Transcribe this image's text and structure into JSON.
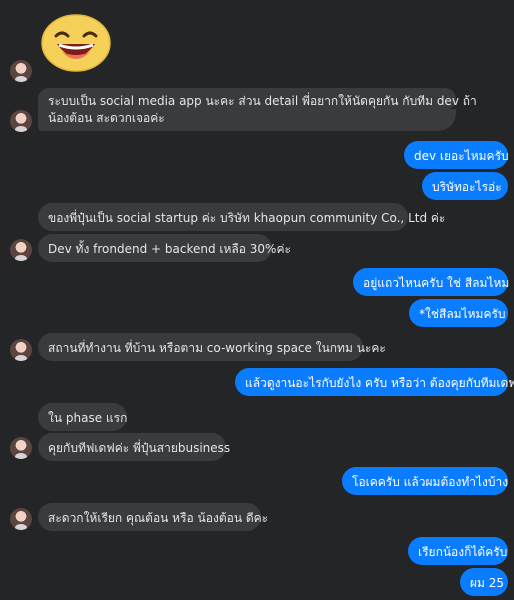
{
  "messages": [
    {
      "side": "in",
      "text": "ระบบเป็น social media app นะคะ ส่วน detail พี่อยากให้นัดคุยกัน กับทีม dev ถ้า"
    },
    {
      "side": "in",
      "text": "น้องต้อน สะดวกเจอค่ะ"
    },
    {
      "side": "out",
      "text": "dev เยอะไหมครับ"
    },
    {
      "side": "out",
      "text": "บริษัทอะไรอ่ะ"
    },
    {
      "side": "in",
      "text": "ของพี่ปุ๋นเป็น social startup ค่ะ บริษัท khaopun community Co., Ltd ค่ะ"
    },
    {
      "side": "in",
      "text": "Dev ทั้ง frondend + backend เหลือ 30%ค่ะ"
    },
    {
      "side": "out",
      "text": "อยู่แถวไหนครับ ใช่ สีลมไหม"
    },
    {
      "side": "out",
      "text": "*ใช่สีลมไหมครับ"
    },
    {
      "side": "in",
      "text": "สถานที่ทำงาน ที่บ้าน หรือตาม co-working space ในกทม นะคะ"
    },
    {
      "side": "out",
      "text": "แล้วดูงานอะไรกับยังไง ครับ หรือว่า ต้องคุยกับทีมเดฟ"
    },
    {
      "side": "in",
      "text": "ใน phase แรก"
    },
    {
      "side": "in",
      "text": "คุยกับทีฟเดฟค่ะ พี่ปุ๋นสายbusiness"
    },
    {
      "side": "out",
      "text": "โอเคครับ แล้วผมต้องทำไงบ้าง"
    },
    {
      "side": "in",
      "text": "สะดวกให้เรียก คุณต้อน หรือ น้องต้อน ดีคะ"
    },
    {
      "side": "out",
      "text": "เรียกน้องก็ได้ครับ"
    },
    {
      "side": "out",
      "text": "ผม 25"
    }
  ],
  "icons": {
    "sticker": "laughing-face-icon",
    "avatar": "contact-avatar"
  },
  "colors": {
    "background": "#242526",
    "incoming_bubble": "#3a3b3c",
    "outgoing_bubble": "#0a7cff",
    "text": "#e4e6eb"
  }
}
